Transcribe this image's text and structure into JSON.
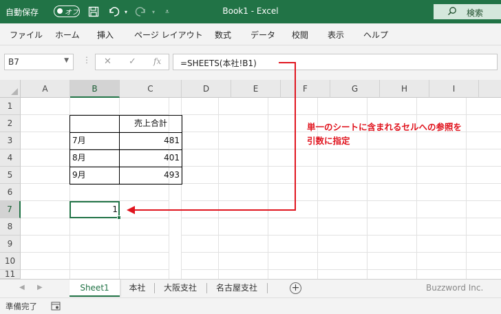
{
  "titlebar": {
    "autosave_label": "自動保存",
    "autosave_state": "オフ",
    "doc_title": "Book1  -  Excel",
    "search_label": "検索",
    "icons": [
      "save-icon",
      "undo-icon",
      "redo-icon",
      "customize-icon",
      "search-icon"
    ]
  },
  "menu": {
    "items": [
      "ファイル",
      "ホーム",
      "挿入",
      "ページ レイアウト",
      "数式",
      "データ",
      "校閲",
      "表示",
      "ヘルプ"
    ]
  },
  "formula_bar": {
    "name_box": "B7",
    "formula": "=SHEETS(本社!B1)",
    "icons": [
      "cancel-icon",
      "enter-icon",
      "fx-icon"
    ]
  },
  "grid": {
    "columns": [
      "A",
      "B",
      "C",
      "D",
      "E",
      "F",
      "G",
      "H",
      "I"
    ],
    "rows": [
      "1",
      "2",
      "3",
      "4",
      "5",
      "6",
      "7",
      "8",
      "9",
      "10",
      "11"
    ],
    "selected_column": "B",
    "selected_row": "7",
    "table": {
      "header": "売上合計",
      "rows": [
        {
          "label": "7月",
          "value": "481"
        },
        {
          "label": "8月",
          "value": "401"
        },
        {
          "label": "9月",
          "value": "493"
        }
      ]
    },
    "active_cell_value": "1"
  },
  "annotation": {
    "line1": "単一のシートに含まれるセルへの参照を",
    "line2": "引数に指定",
    "color": "#e0141e"
  },
  "sheet_tabs": {
    "tabs": [
      "Sheet1",
      "本社",
      "大阪支社",
      "名古屋支社"
    ],
    "active": "Sheet1",
    "watermark": "Buzzword Inc."
  },
  "status": {
    "text": "準備完了"
  },
  "colors": {
    "accent": "#217346",
    "annotation": "#e0141e"
  }
}
